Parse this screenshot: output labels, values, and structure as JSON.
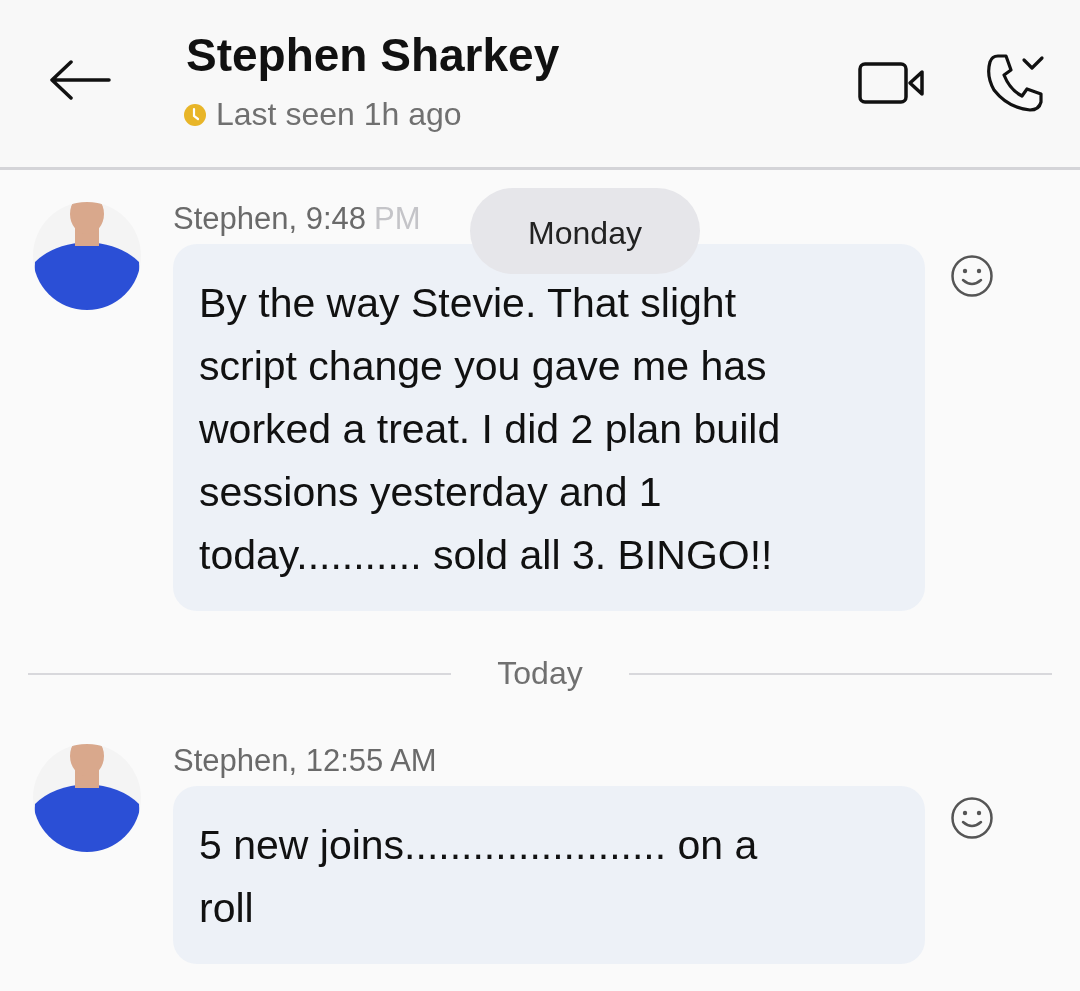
{
  "header": {
    "title": "Stephen Sharkey",
    "status": {
      "text": "Last seen 1h ago",
      "away": true
    }
  },
  "floating_date": "Monday",
  "timeline": [
    {
      "kind": "message",
      "sender": "Stephen, 9:48",
      "sender_faded": "PM",
      "text": "By the way Stevie. That slight script change you gave me has worked a treat. I did 2 plan build sessions yesterday and 1 today........... sold all 3. BINGO!!"
    },
    {
      "kind": "divider",
      "label": "Today"
    },
    {
      "kind": "message",
      "sender": "Stephen, 12:55 AM",
      "text": "5 new joins....................... on a roll"
    }
  ]
}
